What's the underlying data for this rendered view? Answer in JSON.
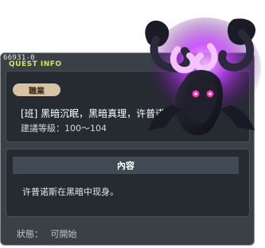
{
  "window": {
    "quest_id": "66931-0",
    "panel_title": "QUEST INFO"
  },
  "quest": {
    "job_badge": "職業",
    "name": "[班] 黑暗沉眠，黑暗真理，许普诺斯",
    "level_requirement": "建議等級：100～104"
  },
  "content": {
    "header": "內容",
    "text": "许普诺斯在黑暗中现身。"
  },
  "status": {
    "label": "狀態：",
    "value": "可開始"
  },
  "icons": {
    "boss_art": "hypnos-boss-portrait-icon"
  },
  "colors": {
    "window_bg": "#3b4046",
    "panel_bg": "#262b31",
    "title_accent": "#d8e36a",
    "badge_bg": "#d8c3a4",
    "boss_glow": "#c43dff"
  }
}
